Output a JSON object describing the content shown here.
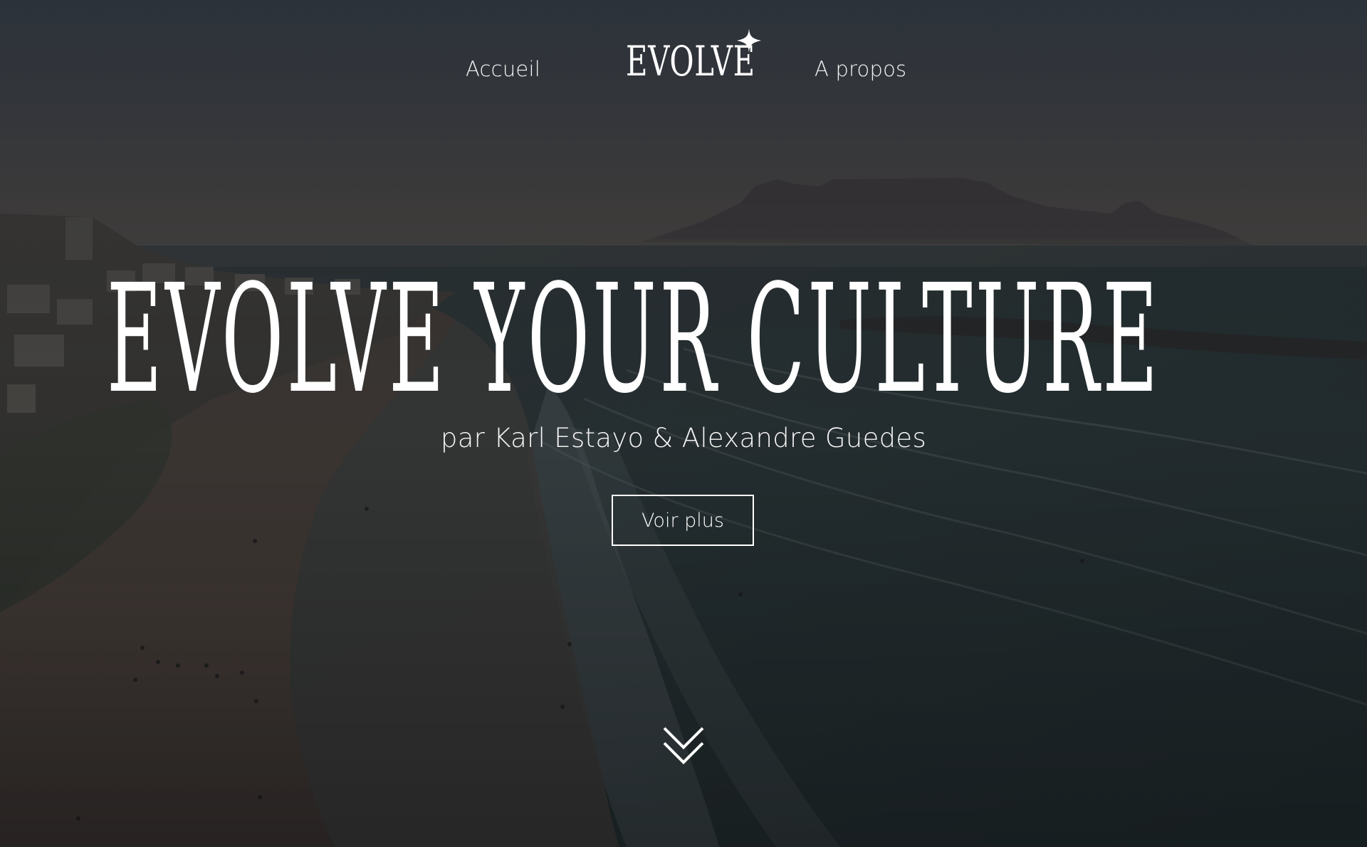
{
  "nav": {
    "home_label": "Accueil",
    "about_label": "A propos",
    "logo_text": "EVOLVE"
  },
  "hero": {
    "headline": "EVOLVE YOUR CULTURE",
    "subtitle": "par Karl Estayo & Alexandre Guedes",
    "cta_label": "Voir plus"
  },
  "icons": {
    "logo_star": "sparkle-icon",
    "scroll": "double-chevron-down-icon"
  },
  "colors": {
    "text": "#ffffff",
    "overlay": "#1f2226"
  }
}
